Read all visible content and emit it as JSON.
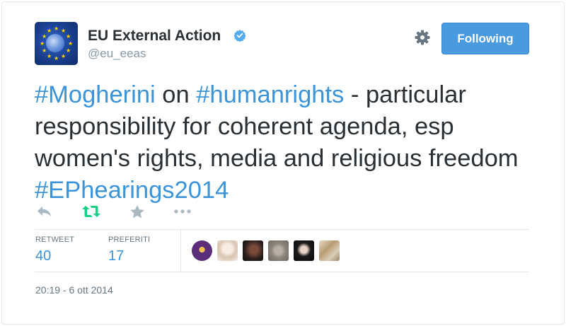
{
  "header": {
    "display_name": "EU External Action",
    "handle": "@eu_eeas",
    "follow_label": "Following",
    "avatar_icon": "eu-globe-stars-avatar",
    "verified_icon": "verified-badge-icon",
    "settings_icon": "gear-icon"
  },
  "tweet": {
    "segments": [
      {
        "text": "#Mogherini",
        "type": "hashtag"
      },
      {
        "text": " on ",
        "type": "text"
      },
      {
        "text": "#humanrights",
        "type": "hashtag"
      },
      {
        "text": " - particular responsibility for coherent agenda, esp women's rights, media and religious freedom ",
        "type": "text"
      },
      {
        "text": "#EPhearings2014",
        "type": "hashtag"
      }
    ]
  },
  "actions": {
    "reply_icon": "reply-icon",
    "retweet_icon": "retweet-icon",
    "favorite_icon": "star-icon",
    "more_icon": "more-dots-icon"
  },
  "stats": {
    "retweets_label": "RETWEET",
    "retweets_value": "40",
    "favorites_label": "PREFERITI",
    "favorites_value": "17"
  },
  "favoriters": [
    {
      "name": "favoriter-avatar-1",
      "color": "#5b2d7a"
    },
    {
      "name": "favoriter-avatar-2",
      "color": "#e9d9cc"
    },
    {
      "name": "favoriter-avatar-3",
      "color": "#2a1e1c"
    },
    {
      "name": "favoriter-avatar-4",
      "color": "#9a9187"
    },
    {
      "name": "favoriter-avatar-5",
      "color": "#1a1a1a"
    },
    {
      "name": "favoriter-avatar-6",
      "color": "#c9b79a"
    }
  ],
  "timestamp": "20:19 - 6 ott 2014",
  "colors": {
    "link": "#3b94d9",
    "follow_button": "#4a9ae0",
    "retweet_active": "#19cf86",
    "icon_gray": "#aab8c2"
  }
}
